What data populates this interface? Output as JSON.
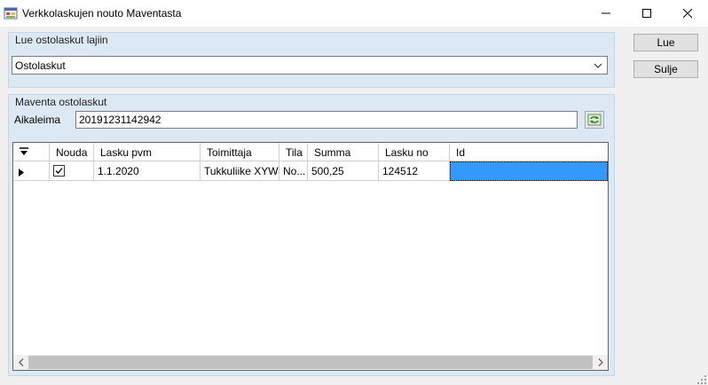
{
  "window": {
    "title": "Verkkolaskujen nouto Maventasta"
  },
  "purchase_type_group": {
    "label": "Lue ostolaskut lajiin",
    "selected_value": "Ostolaskut"
  },
  "maventa_group": {
    "label": "Maventa ostolaskut",
    "timestamp_label": "Aikaleima",
    "timestamp_value": "20191231142942"
  },
  "grid": {
    "columns": [
      "Nouda",
      "Lasku pvm",
      "Toimittaja",
      "Tila",
      "Summa",
      "Lasku no",
      "Id"
    ],
    "rows": [
      {
        "nouda": "checked",
        "lasku_pvm": "1.1.2020",
        "toimittaja": "Tukkuliike XYW",
        "tila": "No...",
        "summa": "500,25",
        "lasku_no": "124512",
        "id": ""
      }
    ]
  },
  "buttons": {
    "read_label": "Lue",
    "close_label": "Sulje"
  },
  "icons": {
    "app": "app-form-icon",
    "minimize": "minimize-icon",
    "maximize": "maximize-icon",
    "close": "close-icon",
    "dropdown": "chevron-down-icon",
    "refresh": "refresh-icon",
    "column_chooser": "column-chooser-icon",
    "row_indicator": "row-pointer-icon",
    "checkbox": "checkbox-checked-icon",
    "scroll_left": "scroll-left-icon",
    "scroll_right": "scroll-right-icon",
    "resize_grip": "resize-grip-icon"
  },
  "colors": {
    "group_background": "#dde8f5",
    "selection": "#3399ff",
    "window_background": "#f0f0f0"
  }
}
